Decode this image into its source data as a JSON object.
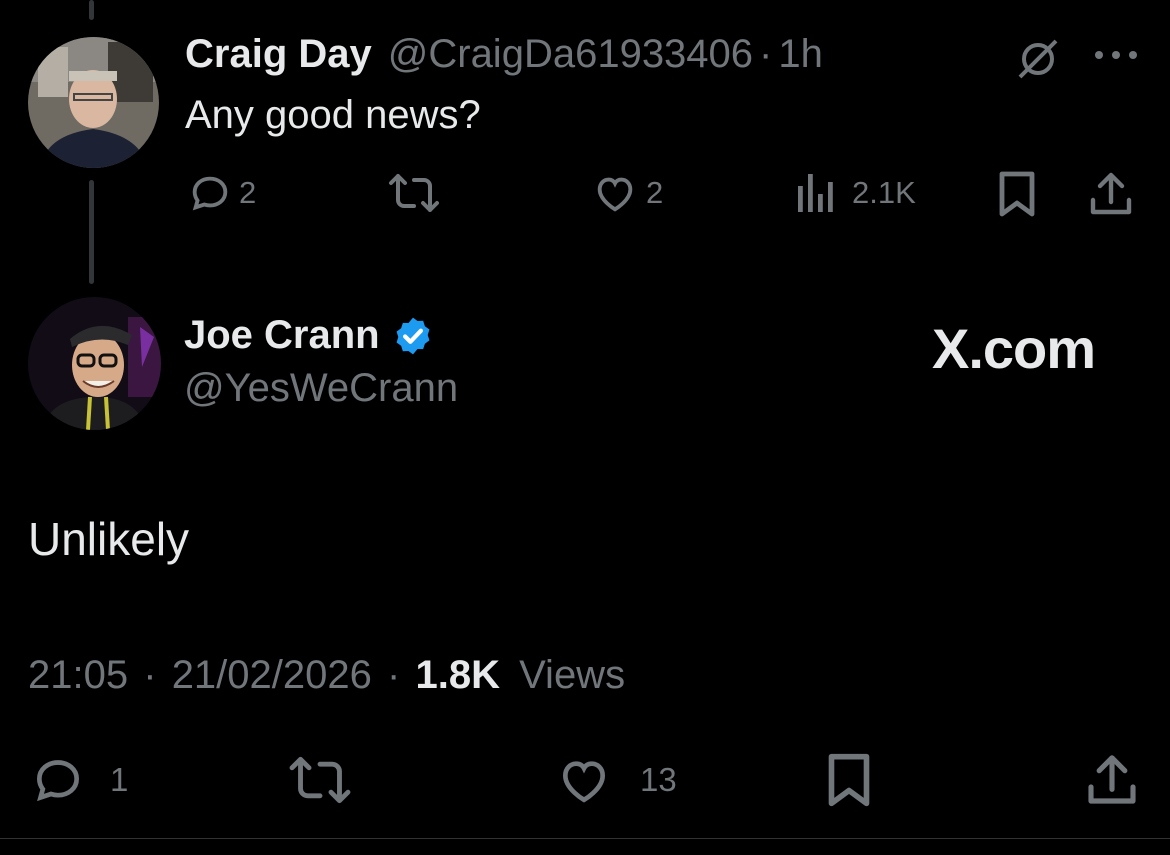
{
  "reply_tweet": {
    "author_name": "Craig Day",
    "author_handle": "@CraigDa61933406",
    "separator": "·",
    "time_ago": "1h",
    "text": "Any good news?",
    "actions": {
      "replies": "2",
      "likes": "2",
      "views": "2.1K"
    }
  },
  "main_tweet": {
    "author_name": "Joe Crann",
    "author_handle": "@YesWeCrann",
    "verified": true,
    "watermark": "X.com",
    "text": "Unlikely",
    "time": "21:05",
    "separator": "·",
    "date": "21/02/2026",
    "separator2": "·",
    "views_count": "1.8K",
    "views_label": "Views",
    "actions": {
      "replies": "1",
      "likes": "13"
    }
  },
  "icons": {
    "reply": "reply-icon",
    "repost": "repost-icon",
    "like": "like-icon",
    "views": "views-icon",
    "bookmark": "bookmark-icon",
    "share": "share-icon",
    "more": "more-icon",
    "grok": "grok-icon",
    "verified": "verified-badge-icon"
  },
  "colors": {
    "background": "#000000",
    "text_primary": "#e7e9ea",
    "text_secondary": "#71767b",
    "verified_blue": "#1d9bf0"
  }
}
